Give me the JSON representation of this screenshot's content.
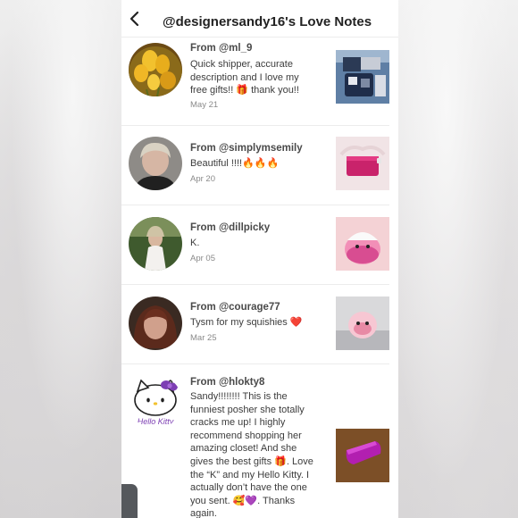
{
  "header": {
    "title": "@designersandy16's Love Notes",
    "back_icon": "chevron-left-icon"
  },
  "notes": [
    {
      "from": "From @ml_9",
      "message": "Quick shipper, accurate description and I love my free gifts!! 🎁 thank you!!",
      "date": "May 21"
    },
    {
      "from": "From @simplymsemily",
      "message": "Beautiful !!!!🔥🔥🔥",
      "date": "Apr 20"
    },
    {
      "from": "From @dillpicky",
      "message": "K.",
      "date": "Apr 05"
    },
    {
      "from": "From @courage77",
      "message": "Tysm for my squishies ❤️",
      "date": "Mar 25"
    },
    {
      "from": "From @hlokty8",
      "message": "Sandy!!!!!!!! This is the funniest posher she totally cracks me up! I highly recommend shopping her amazing closet! And she gives the best gifts 🎁. Love the “K” and my Hello Kitty. I actually don’t have the one you sent. 🥰💜. Thanks again."
    }
  ],
  "avatar_text": {
    "hello_kitty": "Hello Kitty"
  },
  "colors": {
    "text_primary": "#222222",
    "divider": "#ececec",
    "date_gray": "#8a8a8a",
    "background": "#ffffff"
  }
}
